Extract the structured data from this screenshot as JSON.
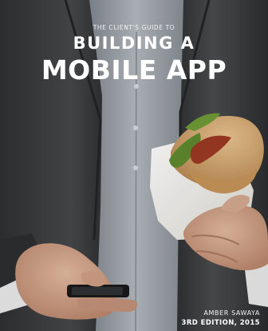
{
  "book": {
    "kicker": "THE CLIENT'S GUIDE TO",
    "title_line1": "BUILDING A",
    "title_line2": "MOBILE APP",
    "author": "AMBER SAWAYA",
    "edition": "3RD EDITION, 2015"
  },
  "photo": {
    "description_icon": "man-holding-sandwich-and-phone-photo",
    "colors": {
      "jacket": "#3b3d3f",
      "shirt": "#9aa1a8",
      "skin": "#cfa38a",
      "paper": "#f1efe9",
      "bread": "#d8b07a",
      "lettuce": "#5f8a2e",
      "bacon": "#9c3a24",
      "phone": "#1b1b1b"
    }
  }
}
